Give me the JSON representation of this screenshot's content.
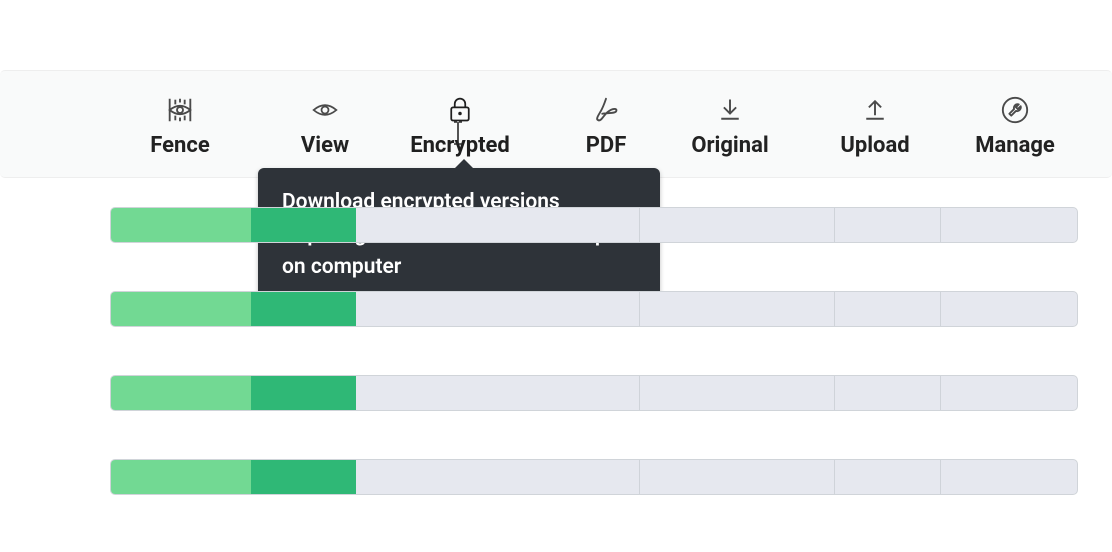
{
  "toolbar": {
    "items": [
      {
        "key": "fence",
        "label": "Fence",
        "icon": "fence-eye-icon"
      },
      {
        "key": "view",
        "label": "View",
        "icon": "eye-icon"
      },
      {
        "key": "encrypted",
        "label": "Encrypted",
        "icon": "lock-icon"
      },
      {
        "key": "pdf",
        "label": "PDF",
        "icon": "pdf-icon"
      },
      {
        "key": "original",
        "label": "Original",
        "icon": "download-icon"
      },
      {
        "key": "upload",
        "label": "Upload",
        "icon": "upload-icon"
      },
      {
        "key": "manage",
        "label": "Manage",
        "icon": "wrench-circle-icon"
      }
    ]
  },
  "tooltip": {
    "for": "encrypted",
    "text": "Download encrypted versions requiring user authentication to open on computer"
  },
  "colors": {
    "toolbar_bg": "#f9fafa",
    "tooltip_bg": "#2e3339",
    "bar_bg": "#e6e8ef",
    "bar_border": "#d0d4d9",
    "seg_light_green": "#72d993",
    "seg_dark_green": "#2fb876"
  },
  "rows": [
    {
      "segments": [
        "g1",
        "g2"
      ]
    },
    {
      "segments": [
        "g1",
        "g2"
      ]
    },
    {
      "segments": [
        "g1",
        "g2"
      ]
    },
    {
      "segments": [
        "g1",
        "g2"
      ]
    }
  ]
}
